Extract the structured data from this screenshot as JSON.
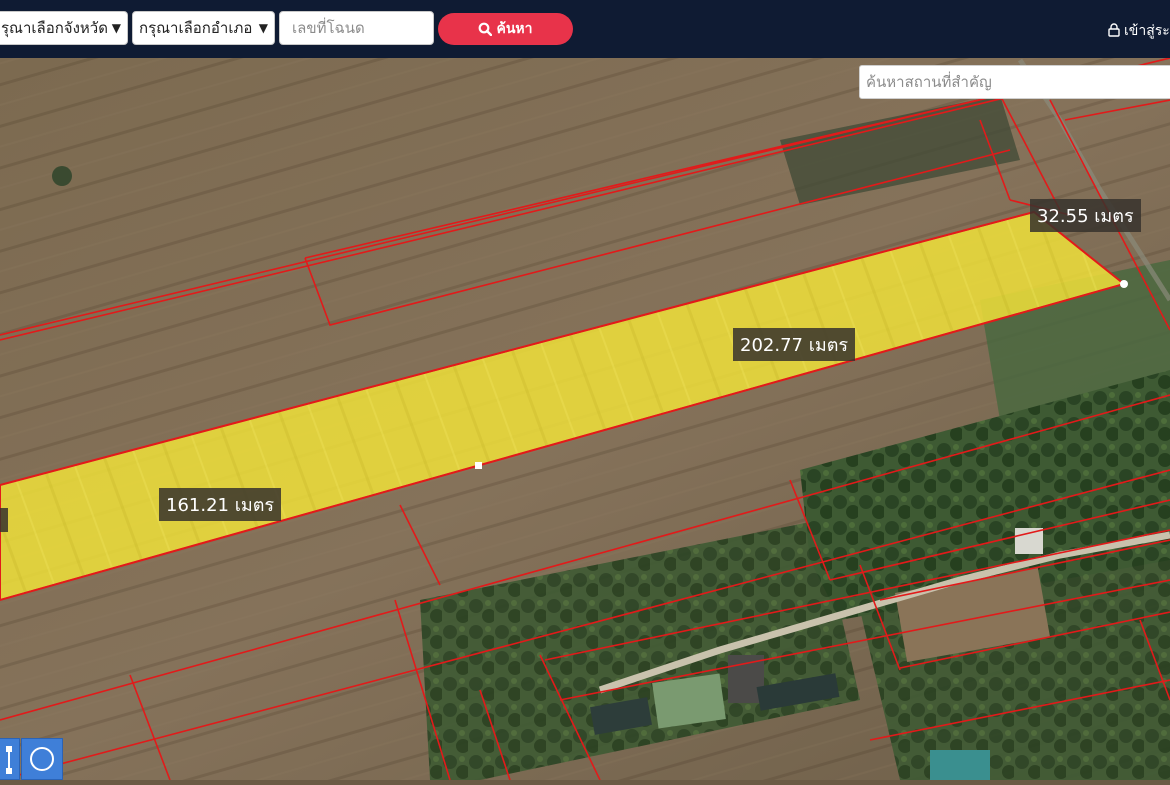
{
  "header": {
    "province_select": "รุณาเลือกจังหวัด",
    "district_select": "กรุณาเลือกอำเภอ",
    "deed_placeholder": "เลขที่โฉนด",
    "search_label": "ค้นหา",
    "login_label": "เข้าสู่ระ"
  },
  "map": {
    "place_search_placeholder": "ค้นหาสถานที่สำคัญ",
    "labels": {
      "top_edge": "32.55 เมตร",
      "long_edge": "202.77 เมตร",
      "bottom_edge": "161.21 เมตร"
    },
    "colors": {
      "parcel_fill": "#f0e13a",
      "boundary": "#e21a1a",
      "header_bg": "#0f1b33",
      "accent": "#e8334a",
      "tool_bg": "#3f7fd8"
    }
  },
  "tools": [
    {
      "icon": "draw-line-icon"
    },
    {
      "icon": "draw-circle-icon"
    }
  ]
}
